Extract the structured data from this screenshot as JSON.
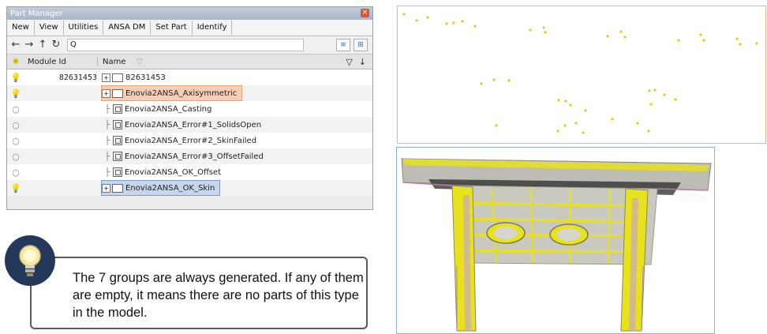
{
  "part_manager": {
    "title": "Part Manager",
    "close_glyph": "×",
    "menu": [
      "New",
      "View",
      "Utilities",
      "ANSA DM",
      "Set Part",
      "Identify"
    ],
    "search_value": "",
    "search_glyph": "Q",
    "columns": {
      "module_id": "Module Id",
      "name": "Name"
    },
    "rows": [
      {
        "module_id": "82631453",
        "name": "82631453",
        "visible": true,
        "type": "folder"
      },
      {
        "module_id": "",
        "name": "Enovia2ANSA_Axisymmetric",
        "visible": true,
        "type": "folder",
        "selected": "orange"
      },
      {
        "module_id": "",
        "name": "Enovia2ANSA_Casting",
        "visible": false,
        "type": "part"
      },
      {
        "module_id": "",
        "name": "Enovia2ANSA_Error#1_SolidsOpen",
        "visible": false,
        "type": "part"
      },
      {
        "module_id": "",
        "name": "Enovia2ANSA_Error#2_SkinFailed",
        "visible": false,
        "type": "part"
      },
      {
        "module_id": "",
        "name": "Enovia2ANSA_Error#3_OffsetFailed",
        "visible": false,
        "type": "part"
      },
      {
        "module_id": "",
        "name": "Enovia2ANSA_OK_Offset",
        "visible": false,
        "type": "part"
      },
      {
        "module_id": "",
        "name": "Enovia2ANSA_OK_Skin",
        "visible": true,
        "type": "folder",
        "selected": "blue"
      }
    ]
  },
  "callout": {
    "text": "The 7 groups are always generated. If any of them are empty, it means there are no parts of this type in the model."
  },
  "icons": {
    "tip": "lightbulb-icon",
    "visible": "lightbulb-on-icon",
    "hidden": "lightbulb-off-icon"
  },
  "colors": {
    "orange_highlight": "#f8cdb6",
    "blue_highlight": "#c7d6ea",
    "point_yellow": "#d7cf1a",
    "mesh_yellow": "#e7e21c",
    "callout_badge": "#24385c"
  }
}
